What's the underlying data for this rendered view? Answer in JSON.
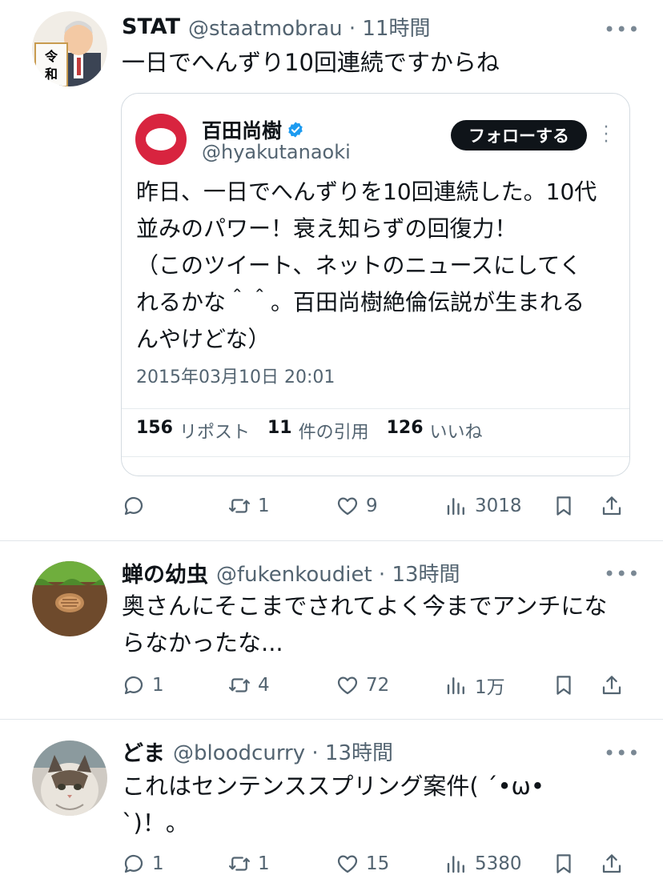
{
  "tweets": [
    {
      "display_name": "STAT",
      "handle_time": "@staatmobrau · 11時間",
      "text_lines": [
        "一日でへんずり10回連続ですからね"
      ],
      "avatar_badge": "令和",
      "replies": "",
      "retweets": "1",
      "likes": "9",
      "views": "3018"
    },
    {
      "display_name": "蝉の幼虫",
      "handle_time": "@fukenkoudiet · 13時間",
      "text_lines": [
        "奥さんにそこまでされてよく今までアンチにな",
        "らなかったな..."
      ],
      "replies": "1",
      "retweets": "4",
      "likes": "72",
      "views": "1万"
    },
    {
      "display_name": "どま",
      "handle_time": "@bloodcurry · 13時間",
      "text_lines": [
        "これはセンテンススプリング案件( ´•ω•",
        "`)！。"
      ],
      "replies": "1",
      "retweets": "1",
      "likes": "15",
      "views": "5380"
    }
  ],
  "quote": {
    "name": "百田尚樹",
    "handle": "@hyakutanaoki",
    "follow_label": "フォローする",
    "text_lines": [
      "昨日、一日でへんずりを10回連続した。10代",
      "並みのパワー！衰え知らずの回復力！",
      "（このツイート、ネットのニュースにしてく",
      "れるかな＾＾。百田尚樹絶倫伝説が生まれる",
      "んやけどな）"
    ],
    "timestamp": "2015年03月10日 20:01",
    "stats": {
      "reposts_count": "156",
      "reposts_label": "リポスト",
      "quotes_count": "11",
      "quotes_label": "件の引用",
      "likes_count": "126",
      "likes_label": "いいね"
    }
  },
  "colors": {
    "accent_verified": "#1d9bf0",
    "secondary_text": "#536471",
    "quote_avatar": "#d8243f"
  },
  "icons": [
    "reply-icon",
    "retweet-icon",
    "like-icon",
    "views-icon",
    "bookmark-icon",
    "share-icon",
    "more-icon",
    "verified-badge-icon"
  ]
}
